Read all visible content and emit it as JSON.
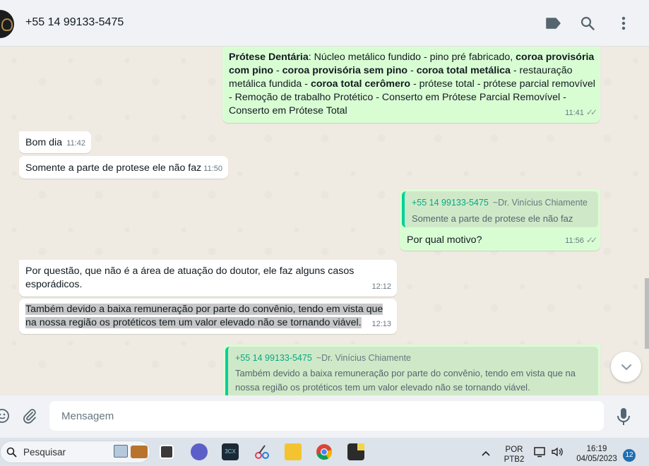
{
  "header": {
    "contact_name": "+55 14 99133-5475"
  },
  "messages": {
    "m1": {
      "seg1_bold": "Prótese Dentária",
      "seg2": ": Núcleo metálico fundido - pino pré fabricado, ",
      "seg3_bold": "coroa provisória com pino",
      "seg4": " - ",
      "seg5_bold": "coroa provisória sem pino",
      "seg6": " - ",
      "seg7_bold": "coroa total metálica",
      "seg8": " - restauração metálica fundida - ",
      "seg9_bold": "coroa total cerômero",
      "seg10": " - prótese total - prótese parcial removível  - Remoção de trabalho Protético  - Conserto em Prótese Parcial Removível - Conserto em Prótese Total",
      "time": "11:41"
    },
    "m2": {
      "text": "Bom dia",
      "time": "11:42"
    },
    "m3": {
      "text": "Somente a parte de protese ele não faz",
      "time": "11:50"
    },
    "m4": {
      "quote_phone": "+55 14 99133-5475",
      "quote_alias": "~Dr. Vinícius Chiamente",
      "quote_text": "Somente a parte de protese ele não faz",
      "text": "Por qual motivo?",
      "time": "11:56"
    },
    "m5": {
      "text": "Por questão, que não é  a área de atuação do doutor, ele faz alguns casos esporádicos.",
      "time": "12:12"
    },
    "m6": {
      "text": "Também devido a baixa remuneração por parte do convênio, tendo em vista que na nossa região os protéticos tem um valor elevado não se tornando viável.",
      "time": "12:13"
    },
    "m7": {
      "quote_phone": "+55 14 99133-5475",
      "quote_alias": "~Dr. Vinícius Chiamente",
      "quote_text": "Também devido a baixa remuneração por parte do convênio, tendo em vista que na nossa região os protéticos tem um valor elevado não se tornando viável."
    }
  },
  "composer": {
    "placeholder": "Mensagem"
  },
  "taskbar": {
    "search_placeholder": "Pesquisar",
    "lang_line1": "POR",
    "lang_line2": "PTB2",
    "clock_time": "16:19",
    "clock_date": "04/05/2023",
    "notification_count": "12"
  },
  "colors": {
    "chat_bg": "#efeae2",
    "outgoing_bubble": "#d9fdd3",
    "incoming_bubble": "#ffffff",
    "quote_accent": "#06cf9c"
  }
}
